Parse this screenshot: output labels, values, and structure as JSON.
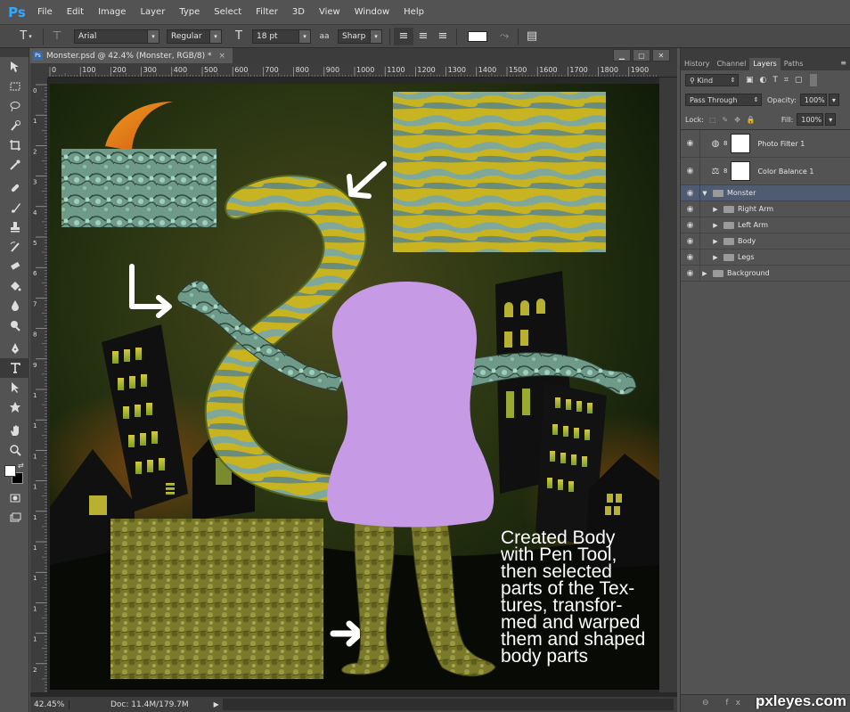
{
  "app": {
    "logo": "Ps"
  },
  "menu": [
    "File",
    "Edit",
    "Image",
    "Layer",
    "Type",
    "Select",
    "Filter",
    "3D",
    "View",
    "Window",
    "Help"
  ],
  "options": {
    "font_family": "Arial",
    "font_style": "Regular",
    "font_size": "18 pt",
    "aa_label": "aa",
    "antialias": "Sharp"
  },
  "document": {
    "tab_title": "Monster.psd @ 42.4% (Monster, RGB/8) *",
    "ruler_top": [
      "0",
      "100",
      "200",
      "300",
      "400",
      "500",
      "600",
      "700",
      "800",
      "900",
      "1000",
      "1100",
      "1200",
      "1300",
      "1400",
      "1500",
      "1600",
      "1700",
      "1800",
      "1900"
    ],
    "ruler_left": [
      "0",
      "1",
      "2",
      "3",
      "4",
      "5",
      "6",
      "7",
      "8",
      "9",
      "1",
      "1",
      "1",
      "1",
      "1",
      "1",
      "1",
      "1",
      "1",
      "2"
    ],
    "zoom": "42.45%",
    "doc_info": "Doc: 11.4M/179.7M"
  },
  "artwork": {
    "caption_lines": [
      "Created Body",
      "with Pen Tool,",
      "then selected",
      "parts of the Tex-",
      "tures, transfor-",
      "med and warped",
      "them and shaped",
      "body parts"
    ]
  },
  "panel": {
    "tabs": [
      "History",
      "Channel",
      "Layers",
      "Paths"
    ],
    "filter_kind": "Kind",
    "blend_mode": "Pass Through",
    "opacity_label": "Opacity:",
    "opacity": "100%",
    "lock_label": "Lock:",
    "fill_label": "Fill:",
    "fill": "100%",
    "layers": [
      {
        "name": "Photo Filter 1",
        "type": "adjust"
      },
      {
        "name": "Color Balance 1",
        "type": "adjust"
      },
      {
        "name": "Monster",
        "type": "group-open"
      },
      {
        "name": "Right Arm",
        "type": "sub"
      },
      {
        "name": "Left Arm",
        "type": "sub"
      },
      {
        "name": "Body",
        "type": "sub"
      },
      {
        "name": "Legs",
        "type": "sub"
      },
      {
        "name": "Background",
        "type": "group"
      }
    ]
  },
  "watermark": "pxleyes.com",
  "colors": {
    "accent": "#31a8ff",
    "body_purple": "#c79ae6",
    "selected_layer": "#4e5b70"
  }
}
